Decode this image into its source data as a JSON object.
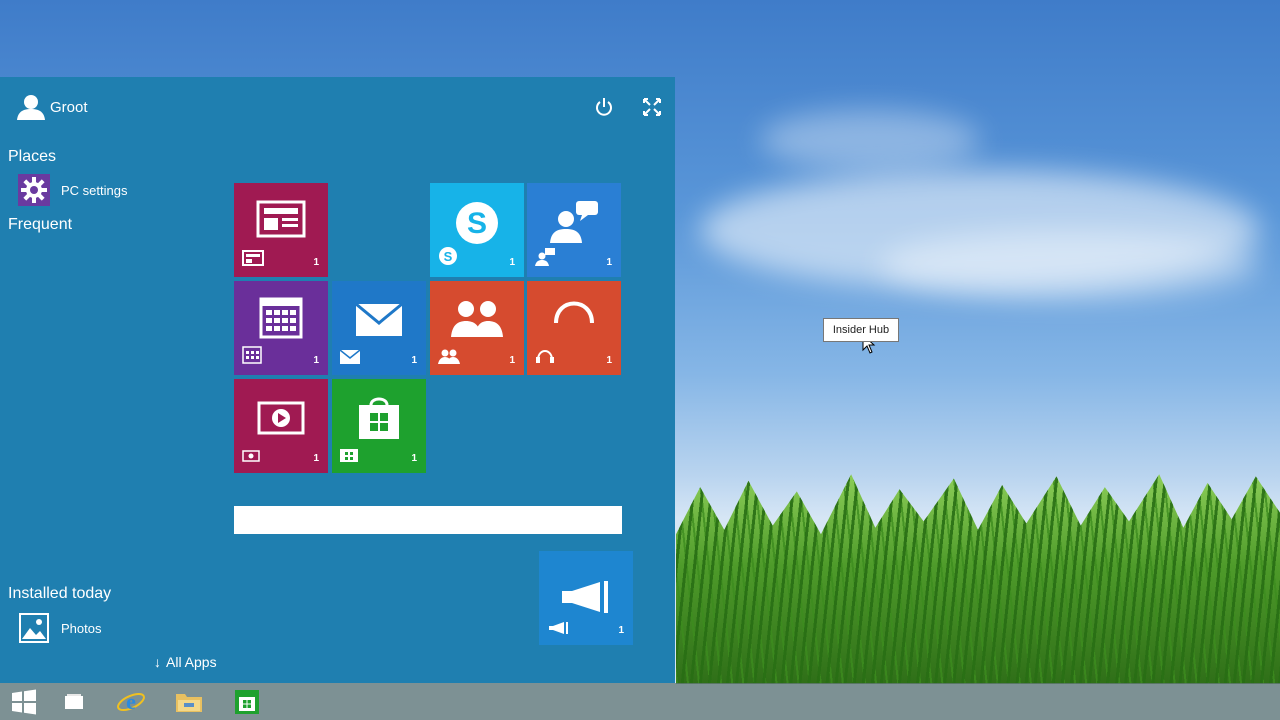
{
  "user": {
    "name": "Groot"
  },
  "sections": {
    "places": "Places",
    "frequent": "Frequent",
    "installed_today": "Installed today"
  },
  "places_items": [
    {
      "label": "PC settings",
      "icon": "gear-icon"
    }
  ],
  "installed_items": [
    {
      "label": "Photos",
      "icon": "photos-icon"
    }
  ],
  "all_apps": "All Apps",
  "tiles": [
    {
      "id": "news",
      "color": "#a01a52",
      "icon": "newspaper-icon",
      "count": "1"
    },
    {
      "id": "skype",
      "color": "#17b3e8",
      "icon": "skype-icon",
      "count": "1"
    },
    {
      "id": "support",
      "color": "#2a7fd4",
      "icon": "chat-person-icon",
      "count": "1"
    },
    {
      "id": "calendar",
      "color": "#6a2f9a",
      "icon": "calendar-icon",
      "count": "1"
    },
    {
      "id": "mail",
      "color": "#1f78c8",
      "icon": "mail-icon",
      "count": "1"
    },
    {
      "id": "people",
      "color": "#d64b2f",
      "icon": "people-icon",
      "count": "1"
    },
    {
      "id": "music",
      "color": "#d64b2f",
      "icon": "headphones-icon",
      "count": "1"
    },
    {
      "id": "video",
      "color": "#a01a52",
      "icon": "video-icon",
      "count": "1"
    },
    {
      "id": "store",
      "color": "#1ea12e",
      "icon": "store-icon",
      "count": "1"
    },
    {
      "id": "insider",
      "color": "#1e86d0",
      "icon": "megaphone-icon",
      "count": "1"
    }
  ],
  "tooltip": "Insider Hub",
  "colors": {
    "start_bg": "#1f7fb0",
    "taskbar": "#647878"
  },
  "taskbar": {
    "items": [
      "windows-start-icon",
      "task-view-icon",
      "internet-explorer-icon",
      "file-explorer-icon",
      "store-icon"
    ]
  }
}
